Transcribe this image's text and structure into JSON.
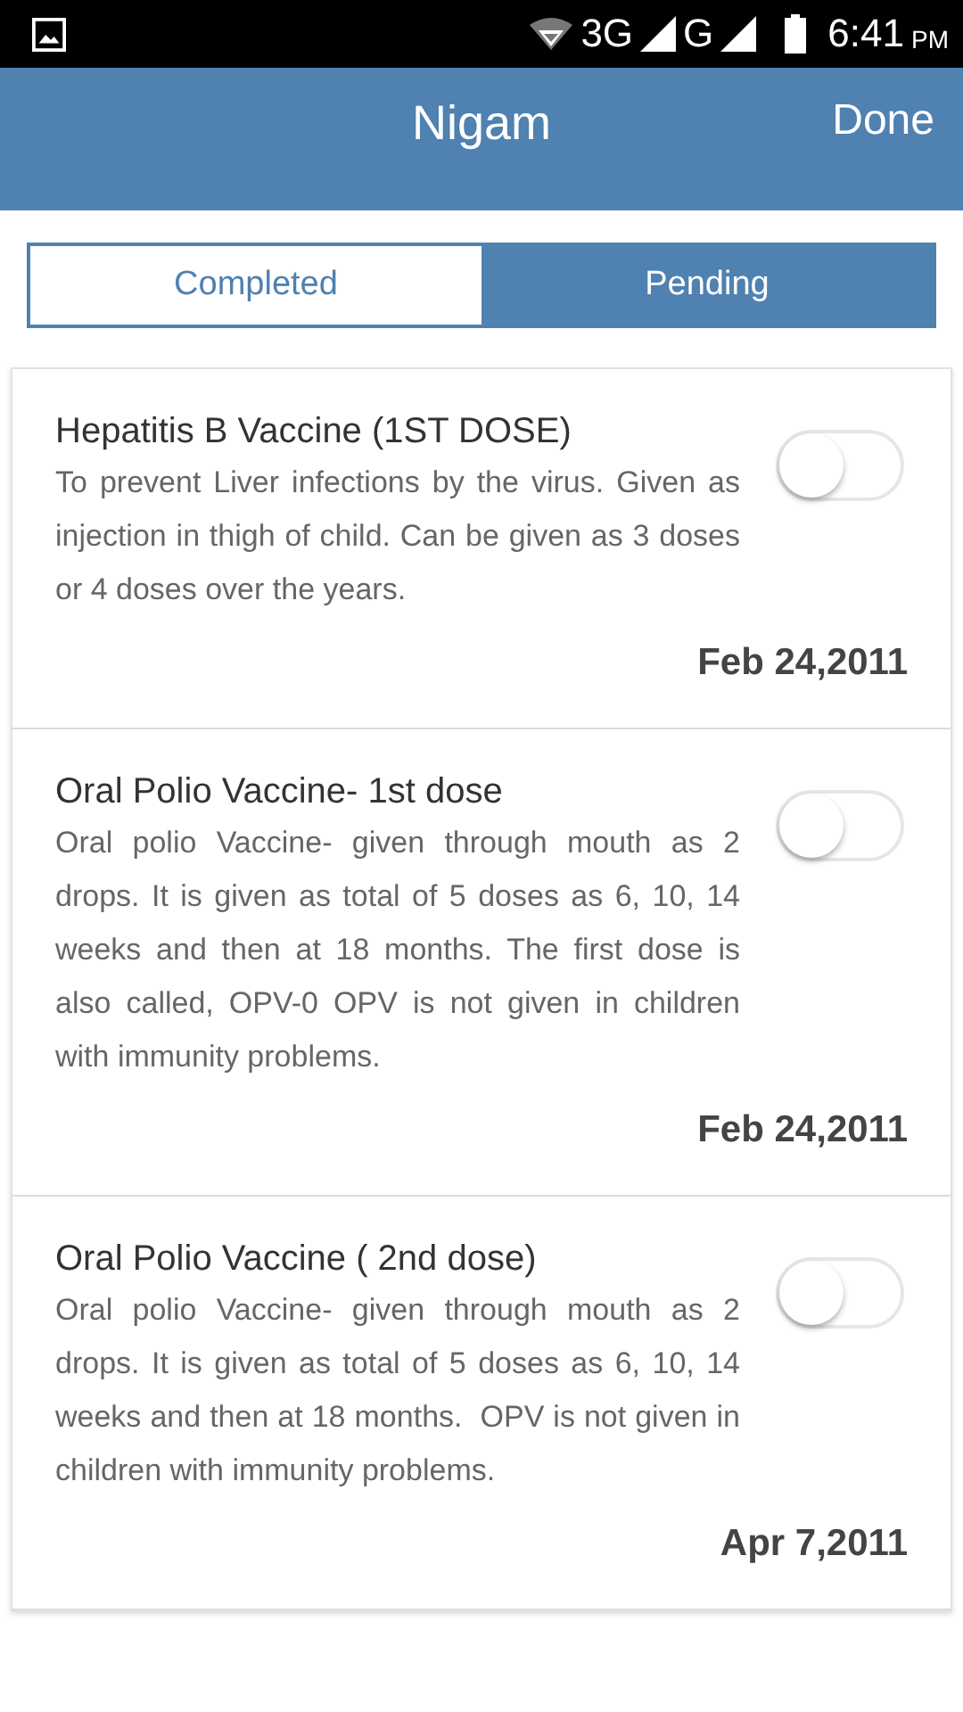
{
  "status_bar": {
    "network": "3G",
    "network_2": "G",
    "time": "6:41",
    "meridiem": "PM"
  },
  "header": {
    "title": "Nigam",
    "action": "Done"
  },
  "tabs": [
    {
      "label": "Completed",
      "selected": true
    },
    {
      "label": "Pending",
      "selected": false
    }
  ],
  "vaccines": [
    {
      "name": "Hepatitis B Vaccine (1ST DOSE)",
      "description": "To prevent Liver infections by the virus. Given as injection in thigh of child. Can be given as 3 doses or 4 doses over the years.",
      "date": "Feb 24,2011",
      "on": false
    },
    {
      "name": "Oral Polio Vaccine- 1st dose",
      "description": "Oral polio Vaccine- given through mouth as 2 drops. It is given as total of 5 doses as 6, 10, 14 weeks and then at 18 months. The first dose is also called, OPV-0 OPV is not given in children with immunity problems.",
      "date": "Feb 24,2011",
      "on": false
    },
    {
      "name": "Oral Polio Vaccine ( 2nd dose)",
      "description": "Oral polio Vaccine- given through mouth as 2 drops. It is given as total of 5 doses as 6, 10, 14 weeks and then at 18 months.  OPV is not given in children with immunity problems.",
      "date": "Apr 7,2011",
      "on": false
    }
  ]
}
